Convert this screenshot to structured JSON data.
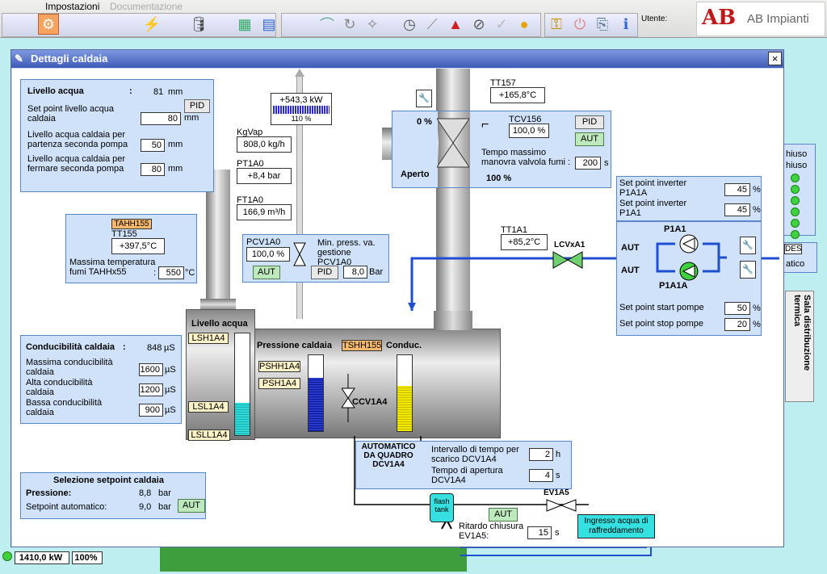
{
  "menu": {
    "settings": "Impostazioni",
    "docs": "Documentazione"
  },
  "toolbar": {
    "user_label": "Utente:"
  },
  "logo": {
    "text": "AB Impianti",
    "mark": "AB"
  },
  "window": {
    "title": "Dettagli caldaia",
    "close": "×"
  },
  "water_level": {
    "title": "Livello acqua",
    "colon": ":",
    "value": "81",
    "unit": "mm",
    "setpoint_label": "Set point livello acqua caldaia",
    "setpoint_value": "80",
    "start_label": "Livello acqua caldaia per partenza seconda pompa",
    "start_value": "50",
    "stop_label": "Livello acqua caldaia per fermare seconda pompa",
    "stop_value": "80",
    "pid": "PID"
  },
  "power": {
    "value": "+543,3 kW",
    "percent": "110 %"
  },
  "steam": {
    "tag": "KgVap",
    "value": "808,0 kg/h"
  },
  "pt1a0": {
    "tag": "PT1A0",
    "value": "+8,4 bar"
  },
  "ft1a0": {
    "tag": "FT1A0",
    "value": "166,9 m³/h"
  },
  "tt155": {
    "alarm": "TAHH155",
    "tag": "TT155",
    "value": "+397,5°C",
    "max_label": "Massima temperatura fumi TAHHx55",
    "max_colon": ":",
    "max_value": "550",
    "unit": "°C"
  },
  "pcv": {
    "tag": "PCV1A0",
    "value": "100,0 %",
    "label": "Min. press. va. gestione PCV1A0",
    "aut": "AUT",
    "pid": "PID",
    "setpoint": "8,0",
    "unit": "Bar"
  },
  "smoke_valve": {
    "percent_left": "0 %",
    "tag": "TCV156",
    "value": "100,0 %",
    "pid": "PID",
    "aut": "AUT",
    "time_label": "Tempo massimo manovra valvola fumi :",
    "time_value": "200",
    "time_unit": "s",
    "state": "Aperto",
    "bottom_percent": "100 %"
  },
  "tt157": {
    "tag": "TT157",
    "value": "+165,8°C"
  },
  "tt1a1": {
    "tag": "TT1A1",
    "value": "+85,2°C"
  },
  "lcv": {
    "tag": "LCVxA1"
  },
  "inverter": {
    "sp_a_label": "Set point inverter P1A1A",
    "sp_a": "45",
    "sp_b_label": "Set point inverter P1A1",
    "sp_b": "45",
    "unit": "%",
    "pump1": "P1A1",
    "pump2": "P1A1A",
    "aut": "AUT",
    "start_label": "Set point start pompe",
    "start_value": "50",
    "stop_label": "Set point stop pompe",
    "stop_value": "20"
  },
  "boiler": {
    "level_title": "Livello acqua",
    "pressure_title": "Pressione caldaia",
    "tshh": "TSHH155",
    "conduc": "Conduc.",
    "lsh": "LSH1A4",
    "lsl": "LSL1A4",
    "lsll": "LSLL1A4",
    "pshh": "PSHH1A4",
    "psh": "PSH1A4",
    "ccv": "CCV1A4",
    "level_fill": 0.32,
    "pressure_fill": 0.7,
    "conduc_fill": 0.6
  },
  "conductivity": {
    "title": "Conducibilità caldaia",
    "colon": ":",
    "value": "848",
    "unit": "µS",
    "max_label": "Massima conducibilità caldaia",
    "max_value": "1600",
    "high_label": "Alta conducibilità caldaia",
    "high_value": "1200",
    "low_label": "Bassa conducibilità caldaia",
    "low_value": "900"
  },
  "discharge": {
    "auto_label": "AUTOMATICO DA QUADRO DCV1A4",
    "interval_label": "Intervallo di tempo per scarico DCV1A4",
    "interval_value": "2",
    "interval_unit": "h",
    "open_label": "Tempo di apertura DCV1A4",
    "open_value": "4",
    "open_unit": "s"
  },
  "ev1a5": {
    "tag": "EV1A5",
    "aut": "AUT",
    "delay_label": "Ritardo chiusura EV1A5:",
    "delay_value": "15",
    "delay_unit": "s",
    "cooling": "Ingresso acqua di raffreddamento",
    "flash": "flash tank"
  },
  "setpoint_sel": {
    "title": "Selezione setpoint caldaia",
    "pressure_label": "Pressione:",
    "pressure_value": "8,8",
    "pressure_unit": "bar",
    "auto_label": "Setpoint automatico:",
    "auto_value": "9,0",
    "auto_unit": "bar",
    "aut": "AUT"
  },
  "background": {
    "chiuso1": "hiuso",
    "chiuso2": "hiuso",
    "des": "DES",
    "atico": "atico",
    "sala": "Sala distribuzione termica",
    "kw": "1410,0 kW",
    "pct": "100%"
  }
}
